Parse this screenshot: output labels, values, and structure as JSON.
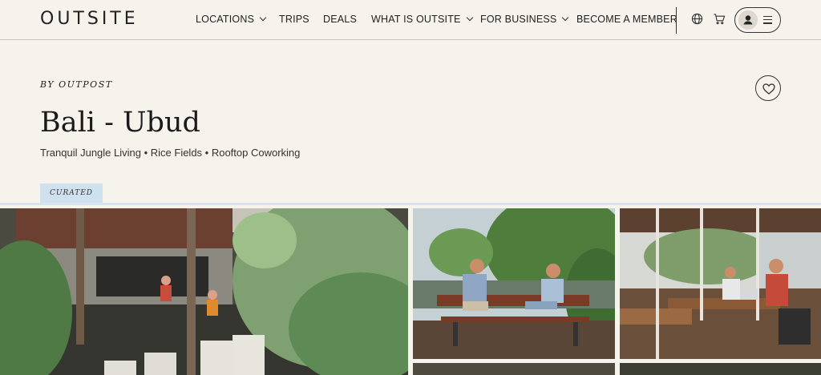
{
  "nav": {
    "logo": "OUTSITE",
    "items": [
      {
        "label": "LOCATIONS",
        "dropdown": true
      },
      {
        "label": "TRIPS",
        "dropdown": false
      },
      {
        "label": "DEALS",
        "dropdown": false
      },
      {
        "label": "WHAT IS OUTSITE",
        "dropdown": true
      },
      {
        "label": "FOR BUSINESS",
        "dropdown": true
      },
      {
        "label": "BECOME A MEMBER",
        "dropdown": false
      }
    ],
    "icons": [
      "globe-icon",
      "cart-icon",
      "user-icon",
      "menu-icon"
    ]
  },
  "header": {
    "byline": "BY OUTPOST",
    "title": "Bali - Ubud",
    "subtitle": "Tranquil Jungle Living • Rice Fields • Rooftop Coworking",
    "badge": "CURATED"
  },
  "colors": {
    "background": "#f6f2ec",
    "badge": "#cfe0ef",
    "text": "#222222"
  }
}
